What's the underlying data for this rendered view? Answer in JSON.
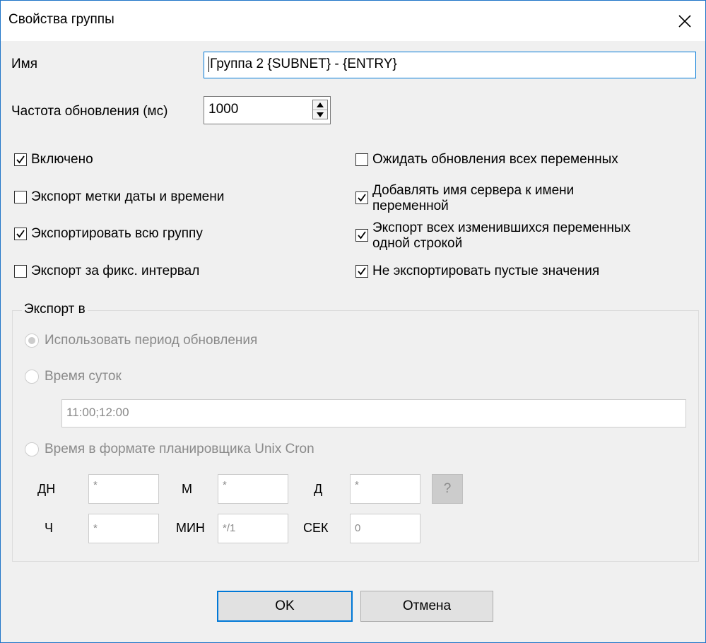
{
  "dialog": {
    "title": "Свойства группы",
    "close_icon": "close-icon"
  },
  "name": {
    "label": "Имя",
    "value": "Группа 2 {SUBNET} - {ENTRY}"
  },
  "refresh_rate": {
    "label": "Частота обновления (мс)",
    "value": "1000"
  },
  "checkboxes": {
    "enabled": {
      "label": "Включено",
      "checked": true
    },
    "export_timestamp": {
      "label": "Экспорт метки даты и времени",
      "checked": false
    },
    "export_whole_group": {
      "label": "Экспортировать всю группу",
      "checked": true
    },
    "export_fixed_interval": {
      "label": "Экспорт за фикс. интервал",
      "checked": false
    },
    "wait_all_vars": {
      "label": "Ожидать обновления всех переменных",
      "checked": false
    },
    "add_server_name": {
      "label_line1": "Добавлять имя сервера к имени",
      "label_line2": "переменной",
      "checked": true
    },
    "export_changed_one_line": {
      "label_line1": "Экспорт всех изменившихся переменных",
      "label_line2": "одной строкой",
      "checked": true
    },
    "no_export_empty": {
      "label": "Не экспортировать пустые значения",
      "checked": true
    }
  },
  "export_to": {
    "title": "Экспорт в",
    "use_update_period": "Использовать период обновления",
    "time_of_day": "Время суток",
    "time_of_day_value": "11:00;12:00",
    "unix_cron": "Время в формате планировщика Unix Cron",
    "selected": "use_update_period",
    "cron": {
      "dn_label": "ДН",
      "dn_value": "*",
      "m_label": "М",
      "m_value": "*",
      "d_label": "Д",
      "d_value": "*",
      "h_label": "Ч",
      "h_value": "*",
      "min_label": "МИН",
      "min_value": "*/1",
      "sec_label": "СЕК",
      "sec_value": "0",
      "help_label": "?"
    }
  },
  "buttons": {
    "ok": "OK",
    "cancel": "Отмена"
  },
  "colors": {
    "accent": "#0078d7",
    "dialog_bg": "#f0f0f0",
    "disabled_text": "#8a8a8a"
  }
}
